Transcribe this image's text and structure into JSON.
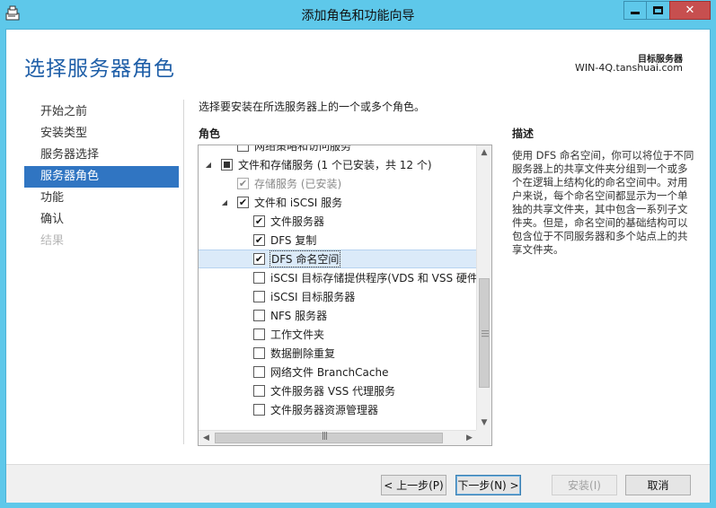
{
  "window": {
    "title": "添加角色和功能向导"
  },
  "header": {
    "page_title": "选择服务器角色",
    "destination_label": "目标服务器",
    "destination_value": "WIN-4Q.tanshuai.com"
  },
  "nav": {
    "items": [
      {
        "label": "开始之前",
        "state": "normal"
      },
      {
        "label": "安装类型",
        "state": "normal"
      },
      {
        "label": "服务器选择",
        "state": "normal"
      },
      {
        "label": "服务器角色",
        "state": "active"
      },
      {
        "label": "功能",
        "state": "normal"
      },
      {
        "label": "确认",
        "state": "normal"
      },
      {
        "label": "结果",
        "state": "disabled"
      }
    ]
  },
  "main": {
    "instruction": "选择要安装在所选服务器上的一个或多个角色。",
    "roles_header": "角色",
    "description_header": "描述",
    "description_text": "使用 DFS 命名空间，你可以将位于不同服务器上的共享文件夹分组到一个或多个在逻辑上结构化的命名空间中。对用户来说，每个命名空间都显示为一个单独的共享文件夹，其中包含一系列子文件夹。但是，命名空间的基础结构可以包含位于不同服务器和多个站点上的共享文件夹。",
    "roles": [
      {
        "label": "网络策略和访问服务",
        "indent": 1,
        "expander": "",
        "check": "none",
        "dim": false,
        "selected": false,
        "focus": false
      },
      {
        "label": "文件和存储服务 (1 个已安装，共 12 个)",
        "indent": 0,
        "expander": "◢",
        "check": "partial",
        "dim": false,
        "selected": false,
        "focus": false
      },
      {
        "label": "存储服务 (已安装)",
        "indent": 1,
        "expander": "",
        "check": "checked",
        "dim": true,
        "selected": false,
        "focus": false
      },
      {
        "label": "文件和 iSCSI 服务",
        "indent": 1,
        "expander": "◢",
        "check": "checked",
        "dim": false,
        "selected": false,
        "focus": false
      },
      {
        "label": "文件服务器",
        "indent": 2,
        "expander": "",
        "check": "checked",
        "dim": false,
        "selected": false,
        "focus": false
      },
      {
        "label": "DFS 复制",
        "indent": 2,
        "expander": "",
        "check": "checked",
        "dim": false,
        "selected": false,
        "focus": false
      },
      {
        "label": "DFS 命名空间",
        "indent": 2,
        "expander": "",
        "check": "checked",
        "dim": false,
        "selected": true,
        "focus": true
      },
      {
        "label": "iSCSI 目标存储提供程序(VDS 和 VSS 硬件提供程序)",
        "indent": 2,
        "expander": "",
        "check": "none",
        "dim": false,
        "selected": false,
        "focus": false
      },
      {
        "label": "iSCSI 目标服务器",
        "indent": 2,
        "expander": "",
        "check": "none",
        "dim": false,
        "selected": false,
        "focus": false
      },
      {
        "label": "NFS 服务器",
        "indent": 2,
        "expander": "",
        "check": "none",
        "dim": false,
        "selected": false,
        "focus": false
      },
      {
        "label": "工作文件夹",
        "indent": 2,
        "expander": "",
        "check": "none",
        "dim": false,
        "selected": false,
        "focus": false
      },
      {
        "label": "数据删除重复",
        "indent": 2,
        "expander": "",
        "check": "none",
        "dim": false,
        "selected": false,
        "focus": false
      },
      {
        "label": "网络文件 BranchCache",
        "indent": 2,
        "expander": "",
        "check": "none",
        "dim": false,
        "selected": false,
        "focus": false
      },
      {
        "label": "文件服务器 VSS 代理服务",
        "indent": 2,
        "expander": "",
        "check": "none",
        "dim": false,
        "selected": false,
        "focus": false
      },
      {
        "label": "文件服务器资源管理器",
        "indent": 2,
        "expander": "",
        "check": "none",
        "dim": false,
        "selected": false,
        "focus": false
      }
    ]
  },
  "footer": {
    "prev_label": "< 上一步(P)",
    "next_label": "下一步(N) >",
    "install_label": "安装(I)",
    "cancel_label": "取消"
  },
  "colors": {
    "title_bar": "#5ec8ea",
    "accent": "#3075c2",
    "page_title": "#1f5fa8",
    "close_button": "#c74f4f"
  }
}
